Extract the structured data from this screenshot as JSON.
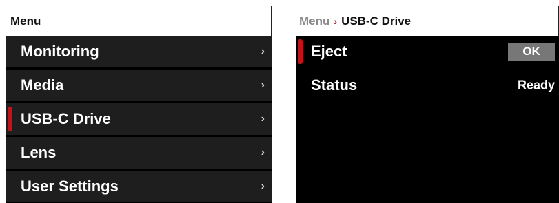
{
  "left_panel": {
    "header_title": "Menu",
    "items": [
      {
        "label": "Monitoring",
        "chevron": "›"
      },
      {
        "label": "Media",
        "chevron": "›"
      },
      {
        "label": "USB-C Drive",
        "chevron": "›"
      },
      {
        "label": "Lens",
        "chevron": "›"
      },
      {
        "label": "User Settings",
        "chevron": "›"
      }
    ],
    "selected_item": "USB-C Drive"
  },
  "right_panel": {
    "breadcrumb": {
      "root": "Menu",
      "separator_icon": "chevron-right-icon",
      "separator": "›",
      "current": "USB-C Drive"
    },
    "rows": [
      {
        "label": "Eject",
        "action_label": "OK"
      },
      {
        "label": "Status",
        "value": "Ready"
      }
    ],
    "selected_row": "Eject"
  },
  "colors": {
    "accent": "#c0141c",
    "panel_bg": "#000000",
    "row_bg": "#1e1e1e",
    "header_bg": "#ffffff",
    "ok_button_bg": "#777777"
  }
}
